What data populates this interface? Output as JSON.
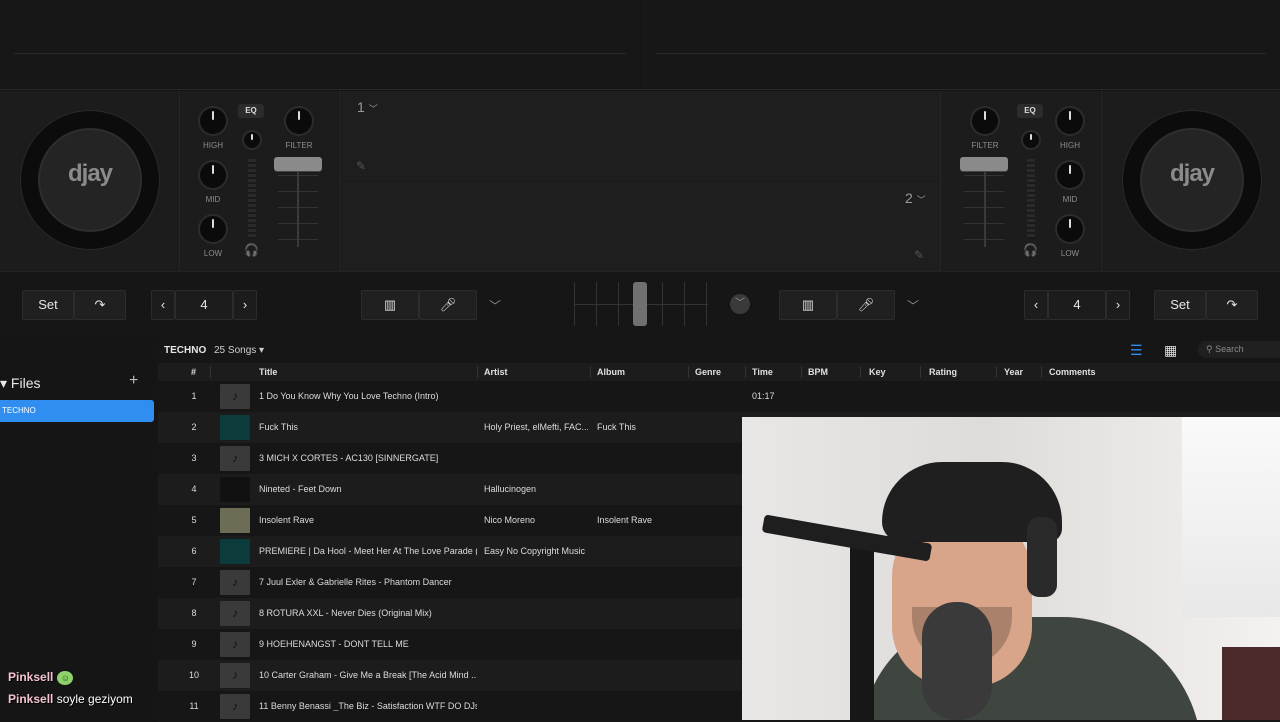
{
  "deck_left": {
    "logo": "djay",
    "knobs": {
      "high": "HIGH",
      "mid": "MID",
      "low": "LOW",
      "filter": "FILTER"
    },
    "eq_label": "EQ",
    "slot_number": "1"
  },
  "deck_right": {
    "logo": "djay",
    "knobs": {
      "high": "HIGH",
      "mid": "MID",
      "low": "LOW",
      "filter": "FILTER"
    },
    "eq_label": "EQ",
    "slot_number": "2"
  },
  "controls": {
    "left": {
      "set_label": "Set",
      "loop_value": "4"
    },
    "right": {
      "set_label": "Set",
      "loop_value": "4"
    }
  },
  "sidebar": {
    "title": "Files",
    "selected_item": "TECHNO"
  },
  "library": {
    "playlist_name": "TECHNO",
    "song_count": "25 Songs",
    "search_placeholder": "Search",
    "columns": [
      "#",
      "Title",
      "Artist",
      "Album",
      "Genre",
      "Time",
      "BPM",
      "Key",
      "Rating",
      "Year",
      "Comments"
    ],
    "rows": [
      {
        "num": "1",
        "title": "1 Do You Know Why You Love Techno (Intro)",
        "artist": "",
        "album": "",
        "time": "01:17",
        "art": "note"
      },
      {
        "num": "2",
        "title": "Fuck This",
        "artist": "Holy Priest, elMefti, FAC...",
        "album": "Fuck This",
        "time": "",
        "art": "cover"
      },
      {
        "num": "3",
        "title": "3 MICH X CORTES - AC130 [SINNERGATE]",
        "artist": "",
        "album": "",
        "time": "",
        "art": "note"
      },
      {
        "num": "4",
        "title": "Nineted - Feet Down",
        "artist": "Hallucinogen",
        "album": "",
        "time": "",
        "art": "cover"
      },
      {
        "num": "5",
        "title": "Insolent Rave",
        "artist": "Nico Moreno",
        "album": "Insolent Rave",
        "time": "",
        "art": "cover"
      },
      {
        "num": "6",
        "title": "PREMIERE | Da Hool - Meet Her At The Love Parade (...",
        "artist": "Easy No Copyright Music",
        "album": "",
        "time": "",
        "art": "cover"
      },
      {
        "num": "7",
        "title": "7 Juul Exler & Gabrielle Rites -  Phantom Dancer",
        "artist": "",
        "album": "",
        "time": "",
        "art": "note"
      },
      {
        "num": "8",
        "title": "8 ROTURA XXL - Never Dies (Original Mix)",
        "artist": "",
        "album": "",
        "time": "",
        "art": "note"
      },
      {
        "num": "9",
        "title": "9 HOEHENANGST - DONT TELL ME",
        "artist": "",
        "album": "",
        "time": "",
        "art": "note"
      },
      {
        "num": "10",
        "title": "10 Carter Graham - Give Me a  Break [The Acid Mind ...",
        "artist": "",
        "album": "",
        "time": "",
        "art": "note"
      },
      {
        "num": "11",
        "title": "11 Benny Benassi _The Biz - Satisfaction WTF DO DJs ...",
        "artist": "",
        "album": "",
        "time": "",
        "art": "note"
      }
    ]
  },
  "chat": [
    {
      "user": "Pinksell",
      "message": "",
      "emote": true
    },
    {
      "user": "Pinksell",
      "message": "soyle geziyom",
      "emote": false
    }
  ],
  "colors": {
    "accent": "#2f8ef0",
    "background": "#141414",
    "chat_user": "#f3c4d0"
  }
}
